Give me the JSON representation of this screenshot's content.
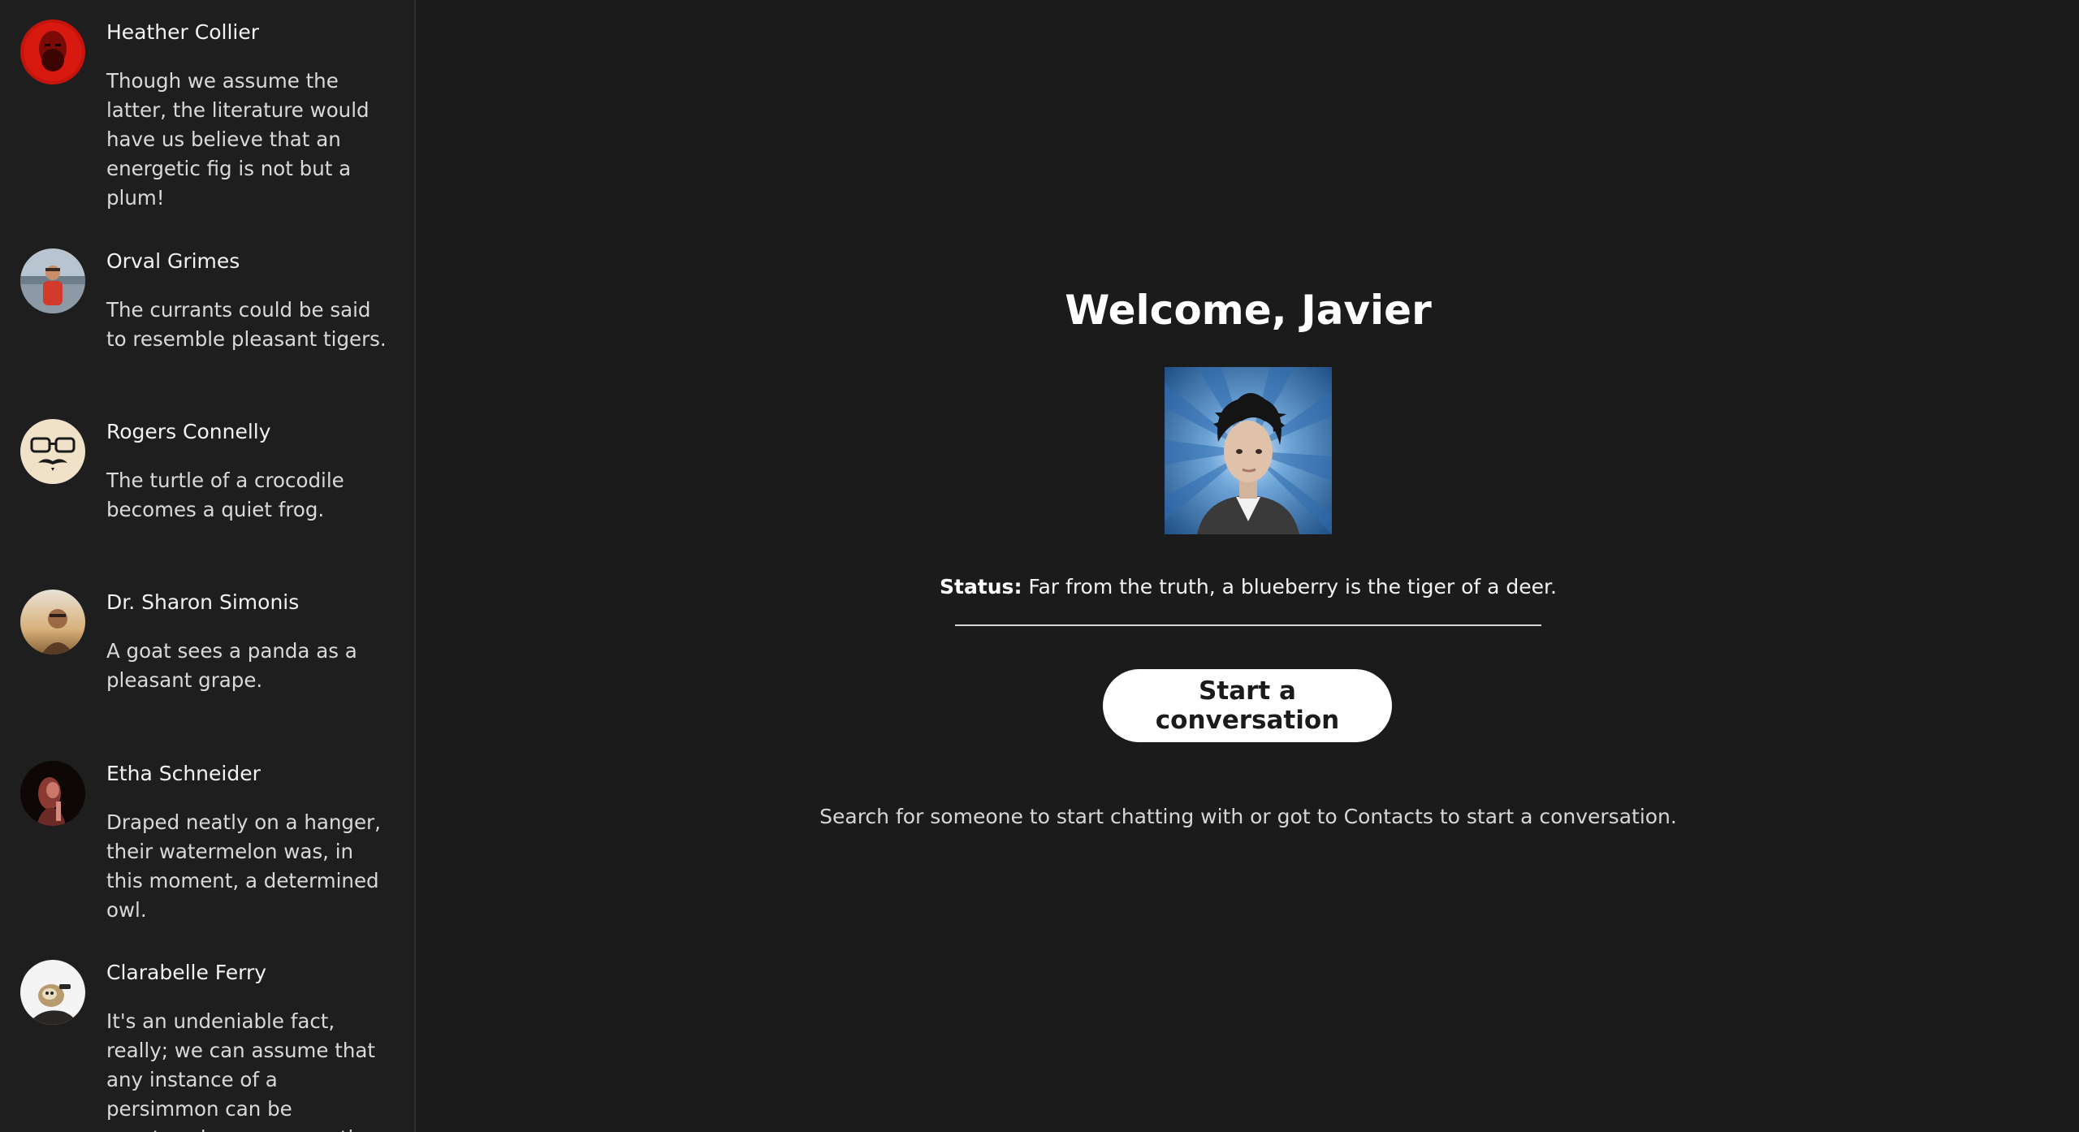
{
  "contacts": [
    {
      "name": "Heather Collier",
      "message": "Though we assume the latter, the literature would have us believe that an energetic fig is not but a plum!",
      "avatar": "red-bearded-man-avatar"
    },
    {
      "name": "Orval Grimes",
      "message": "The currants could be said to resemble pleasant tigers.",
      "avatar": "person-outdoors-avatar"
    },
    {
      "name": "Rogers Connelly",
      "message": "The turtle of a crocodile becomes a quiet frog.",
      "avatar": "glasses-mustache-avatar"
    },
    {
      "name": "Dr. Sharon Simonis",
      "message": "A goat sees a panda as a pleasant grape.",
      "avatar": "sunset-portrait-avatar"
    },
    {
      "name": "Etha Schneider",
      "message": "Draped neatly on a hanger, their watermelon was, in this moment, a determined owl.",
      "avatar": "dark-portrait-avatar"
    },
    {
      "name": "Clarabelle Ferry",
      "message": "It's an undeniable fact, really; we can assume that any instance of a persimmon can be construed as a cooperative",
      "avatar": "sloth-avatar"
    }
  ],
  "main": {
    "welcome": "Welcome, Javier",
    "status_label": "Status:",
    "status_text": "Far from the truth, a blueberry is the tiger of a deer.",
    "start_button": "Start a conversation",
    "hint": "Search for someone to start chatting with or got to Contacts to start a conversation."
  },
  "colors": {
    "background": "#1b1b1c",
    "sidebar": "#1e1e1f",
    "button_bg": "#ffffff",
    "button_text": "#1b1b1c"
  }
}
